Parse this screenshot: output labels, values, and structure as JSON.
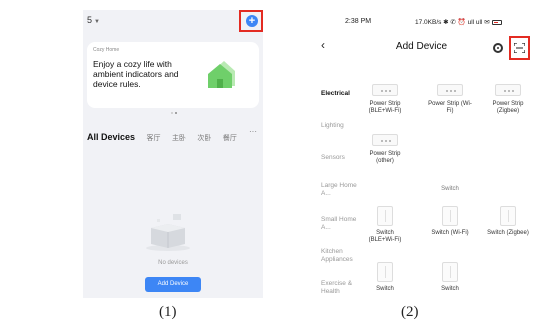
{
  "panel1": {
    "home_selector": "5",
    "cozy_card": {
      "tag": "Cozy Home",
      "text": "Enjoy a cozy life with ambient indicators and device rules."
    },
    "tabs": [
      "All Devices",
      "客厅",
      "主卧",
      "次卧",
      "餐厅"
    ],
    "more_label": "···",
    "empty_text": "No devices",
    "add_device_label": "Add Device",
    "caption": "(1)"
  },
  "panel2": {
    "status": {
      "time": "2:38 PM",
      "right": "17.0KB/s ✱ ✆ ⏰ ull ull ✉"
    },
    "title": "Add Device",
    "categories": [
      "Electrical",
      "Lighting",
      "Sensors",
      "Large Home A...",
      "Small Home A...",
      "Kitchen Appliances",
      "Exercise & Health"
    ],
    "devices": {
      "strip_ble_wifi": "Power Strip (BLE+Wi-Fi)",
      "strip_wifi": "Power Strip (Wi-Fi)",
      "strip_zigbee": "Power Strip (Zigbee)",
      "strip_other": "Power Strip (other)",
      "section_switch": "Switch",
      "switch_ble_wifi": "Switch (BLE+Wi-Fi)",
      "switch_wifi": "Switch (Wi-Fi)",
      "switch_zigbee": "Switch (Zigbee)",
      "switch_a": "Switch",
      "switch_b": "Switch"
    },
    "caption": "(2)"
  },
  "colors": {
    "accent": "#3d86f5",
    "highlight": "#e32b22",
    "house": "#6fcf6a"
  },
  "icons": [
    "plus-icon",
    "back-arrow-icon",
    "radar-icon",
    "scan-icon",
    "house-icon",
    "box-icon",
    "battery-icon"
  ]
}
